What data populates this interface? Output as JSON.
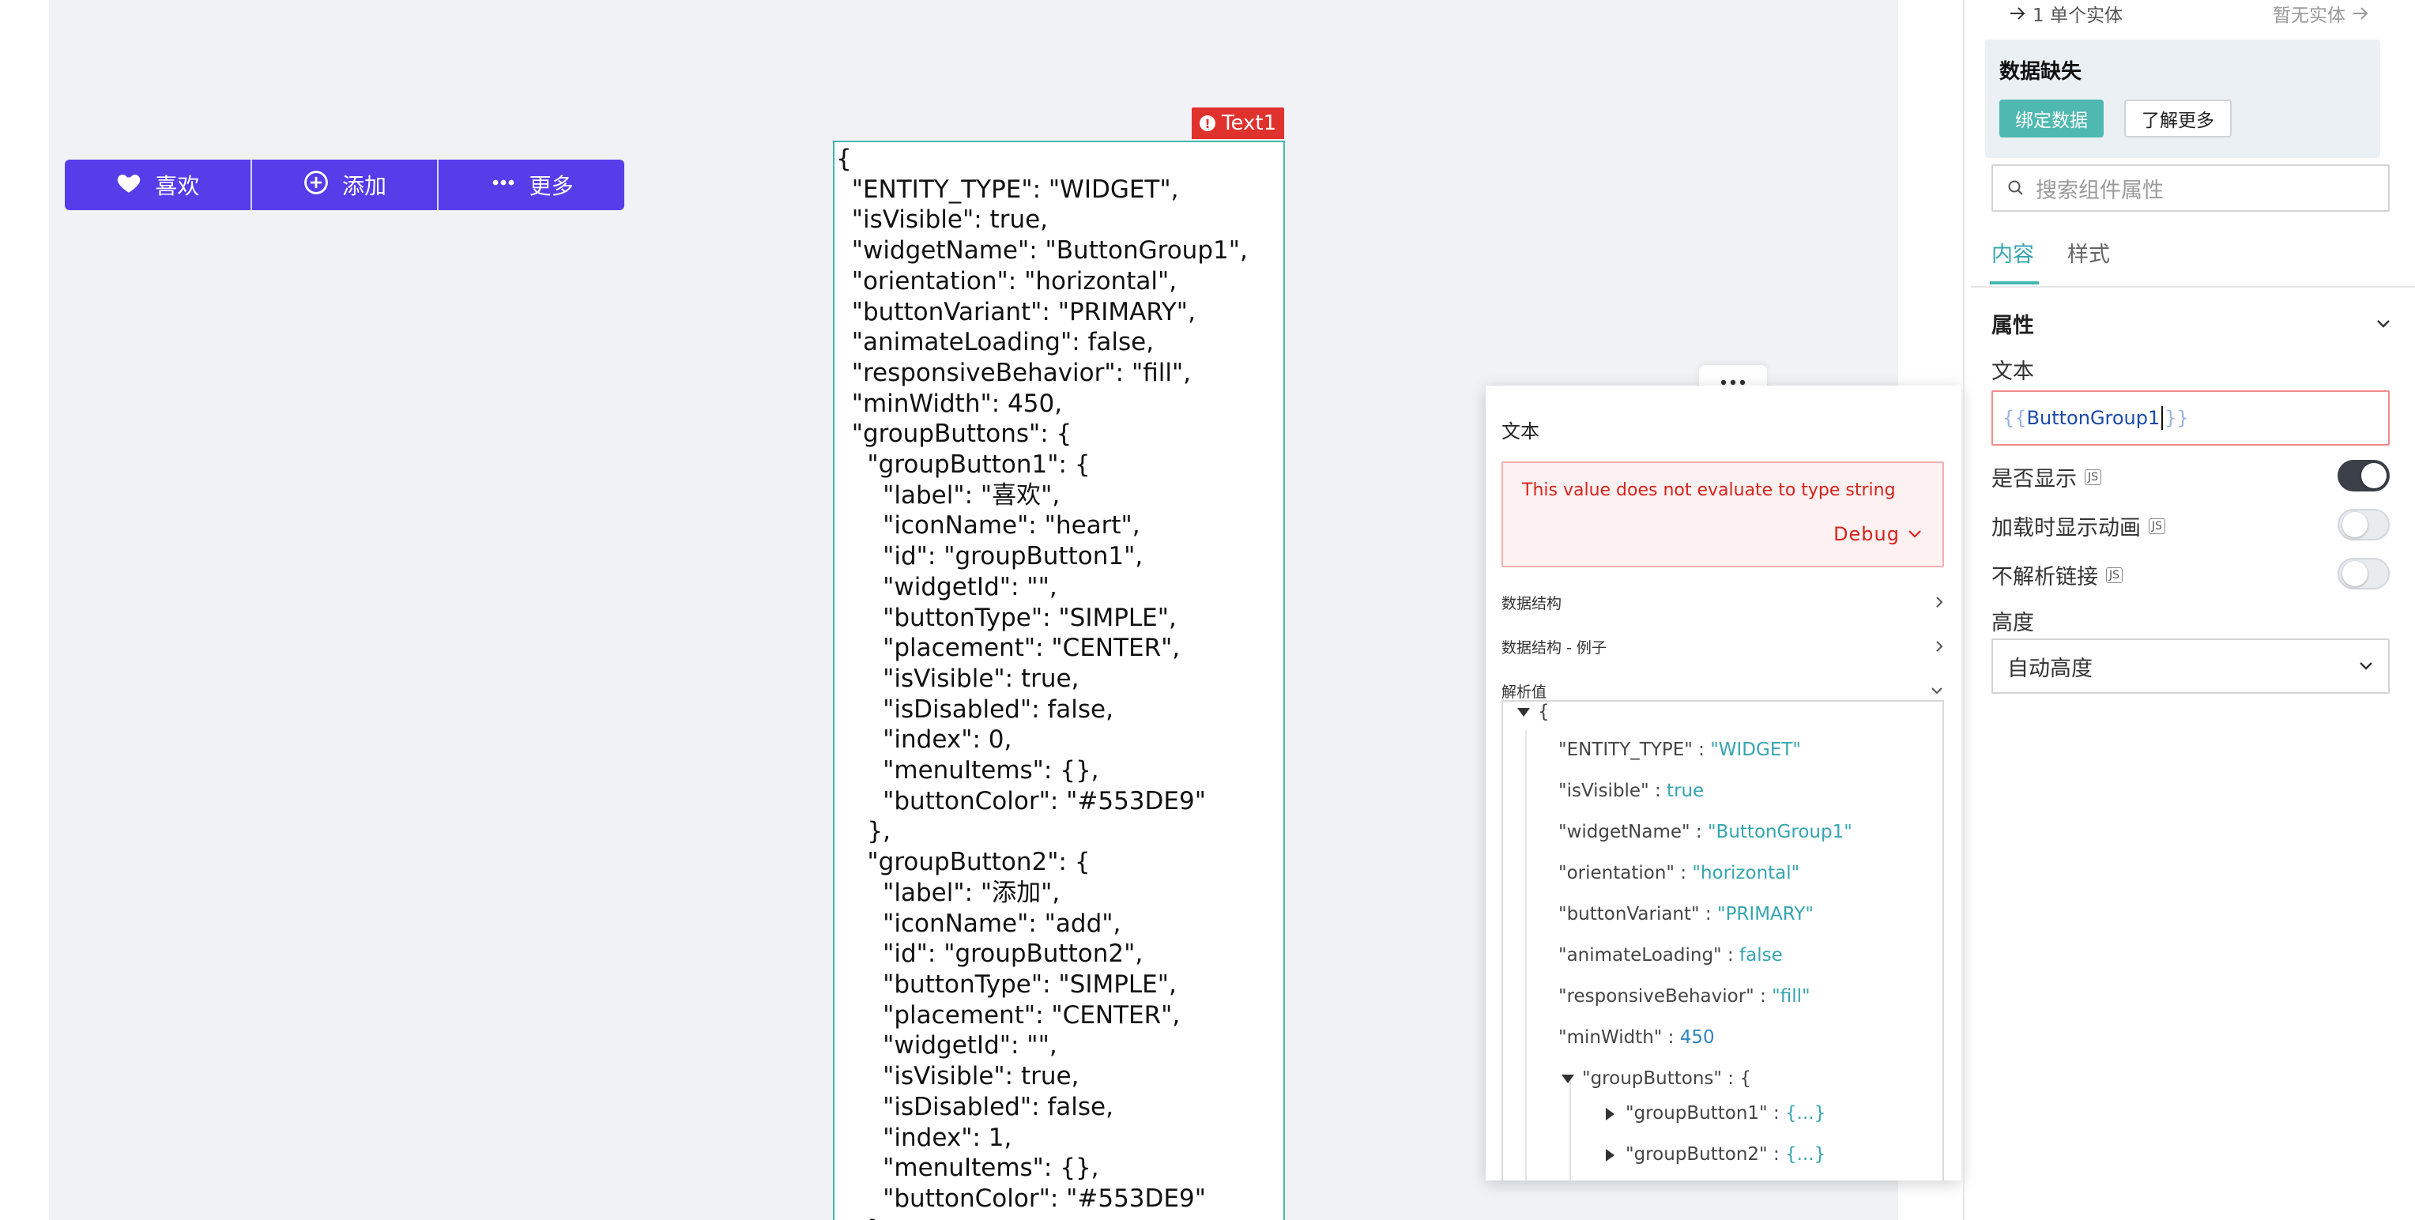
{
  "button_group": {
    "buttons": [
      {
        "label": "喜欢",
        "icon": "heart-icon"
      },
      {
        "label": "添加",
        "icon": "add-circle-icon"
      },
      {
        "label": "更多",
        "icon": "more-dots-icon"
      }
    ],
    "color": "#553DE9"
  },
  "text_widget": {
    "tag": "Text1",
    "content": "{\n  \"ENTITY_TYPE\": \"WIDGET\",\n  \"isVisible\": true,\n  \"widgetName\": \"ButtonGroup1\",\n  \"orientation\": \"horizontal\",\n  \"buttonVariant\": \"PRIMARY\",\n  \"animateLoading\": false,\n  \"responsiveBehavior\": \"fill\",\n  \"minWidth\": 450,\n  \"groupButtons\": {\n    \"groupButton1\": {\n      \"label\": \"喜欢\",\n      \"iconName\": \"heart\",\n      \"id\": \"groupButton1\",\n      \"widgetId\": \"\",\n      \"buttonType\": \"SIMPLE\",\n      \"placement\": \"CENTER\",\n      \"isVisible\": true,\n      \"isDisabled\": false,\n      \"index\": 0,\n      \"menuItems\": {},\n      \"buttonColor\": \"#553DE9\"\n    },\n    \"groupButton2\": {\n      \"label\": \"添加\",\n      \"iconName\": \"add\",\n      \"id\": \"groupButton2\",\n      \"buttonType\": \"SIMPLE\",\n      \"placement\": \"CENTER\",\n      \"widgetId\": \"\",\n      \"isVisible\": true,\n      \"isDisabled\": false,\n      \"index\": 1,\n      \"menuItems\": {},\n      \"buttonColor\": \"#553DE9\"\n    },"
  },
  "eval_popup": {
    "title": "文本",
    "error_message": "This value does not evaluate to type string",
    "debug_label": "Debug",
    "sections": [
      "数据结构",
      "数据结构 - 例子",
      "解析值"
    ],
    "tree": {
      "open": "{",
      "entries": [
        {
          "key": "\"ENTITY_TYPE\"",
          "value": "\"WIDGET\""
        },
        {
          "key": "\"isVisible\"",
          "value": "true"
        },
        {
          "key": "\"widgetName\"",
          "value": "\"ButtonGroup1\""
        },
        {
          "key": "\"orientation\"",
          "value": "\"horizontal\""
        },
        {
          "key": "\"buttonVariant\"",
          "value": "\"PRIMARY\""
        },
        {
          "key": "\"animateLoading\"",
          "value": "false"
        },
        {
          "key": "\"responsiveBehavior\"",
          "value": "\"fill\""
        },
        {
          "key": "\"minWidth\"",
          "value": "450"
        }
      ],
      "group_key": "\"groupButtons\"",
      "group_open": "{",
      "children": [
        {
          "key": "\"groupButton1\"",
          "value": "{...}"
        },
        {
          "key": "\"groupButton2\"",
          "value": "{...}"
        }
      ],
      "sep": ":"
    }
  },
  "property_pane": {
    "entity_link": "1 单个实体",
    "no_entity": "暂无实体",
    "missing_title": "数据缺失",
    "bind_button": "绑定数据",
    "learn_more_button": "了解更多",
    "search_placeholder": "搜索组件属性",
    "tabs": [
      "内容",
      "样式"
    ],
    "section_title": "属性",
    "text_label": "文本",
    "text_value_open": "{{",
    "text_value": "ButtonGroup1",
    "text_value_close": "}}",
    "toggles": [
      {
        "label": "是否显示",
        "on": true
      },
      {
        "label": "加载时显示动画",
        "on": false
      },
      {
        "label": "不解析链接",
        "on": false
      }
    ],
    "js_badge": "JS",
    "height_label": "高度",
    "height_value": "自动高度"
  }
}
